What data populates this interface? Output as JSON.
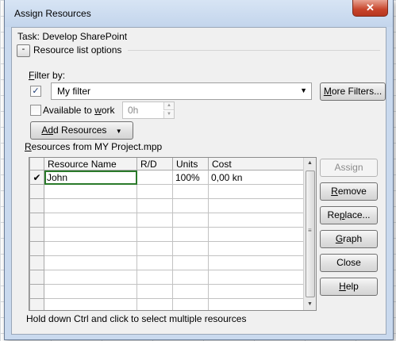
{
  "window": {
    "title": "Assign Resources",
    "close_glyph": "✕"
  },
  "task": {
    "label": "Task: Develop SharePoint"
  },
  "options": {
    "collapse_glyph": "-",
    "label": "Resource list options"
  },
  "filter": {
    "label_prefix": "F",
    "label_rest": "ilter by:",
    "checked": true,
    "check_glyph": "✓",
    "value": "My filter",
    "more_filters_prefix": "M",
    "more_filters_rest": "ore Filters..."
  },
  "available": {
    "label_start": "Available to ",
    "label_underlined": "w",
    "label_end": "ork",
    "value": "0h",
    "up_glyph": "▲",
    "down_glyph": "▼"
  },
  "add_resources": {
    "prefix": "A",
    "underlined": "d",
    "rest": "d Resources",
    "arrow": "▼"
  },
  "resources_from": {
    "prefix": "R",
    "rest": "esources from MY Project.mpp"
  },
  "table": {
    "columns": [
      "Resource Name",
      "R/D",
      "Units",
      "Cost"
    ],
    "rows": [
      {
        "check": "✔",
        "name": "John",
        "rd": "",
        "units": "100%",
        "cost": "0,00 kn"
      }
    ],
    "empty_rows": 10
  },
  "scrollbar": {
    "up_glyph": "▲",
    "down_glyph": "▼",
    "grip": "≡"
  },
  "buttons": {
    "assign": "Assign",
    "remove_prefix": "R",
    "remove_rest": "emove",
    "replace_prefix": "Re",
    "replace_u": "p",
    "replace_rest": "lace...",
    "graph_prefix": "G",
    "graph_rest": "raph",
    "close": "Close",
    "help_prefix": "H",
    "help_rest": "elp"
  },
  "hint": "Hold down Ctrl and click to select multiple resources"
}
